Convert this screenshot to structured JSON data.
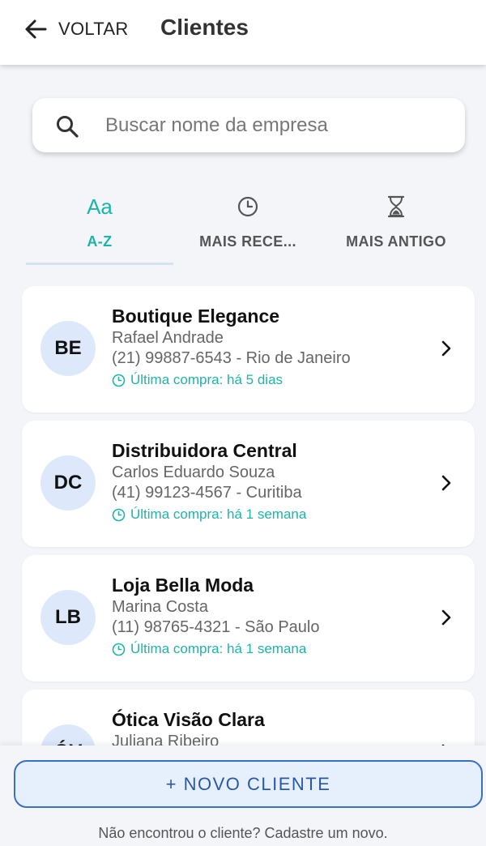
{
  "header": {
    "back_label": "VOLTAR",
    "title": "Clientes"
  },
  "search": {
    "placeholder": "Buscar nome da empresa",
    "value": ""
  },
  "sort_tabs": [
    {
      "icon": "aa-icon",
      "icon_text": "Aa",
      "label": "A-Z",
      "active": true
    },
    {
      "icon": "clock-icon",
      "label": "MAIS RECE...",
      "active": false
    },
    {
      "icon": "hourglass-icon",
      "label": "MAIS ANTIGO",
      "active": false
    }
  ],
  "clients": [
    {
      "initials": "BE",
      "name": "Boutique Elegance",
      "contact": "Rafael Andrade",
      "phone_city": "(21) 99887-6543 - Rio de Janeiro",
      "last_purchase": "Última compra: há 5 dias"
    },
    {
      "initials": "DC",
      "name": "Distribuidora Central",
      "contact": "Carlos Eduardo Souza",
      "phone_city": "(41) 99123-4567 - Curitiba",
      "last_purchase": "Última compra: há 1 semana"
    },
    {
      "initials": "LB",
      "name": "Loja Bella Moda",
      "contact": "Marina Costa",
      "phone_city": "(11) 98765-4321 - São Paulo",
      "last_purchase": "Última compra: há 1 semana"
    },
    {
      "initials": "ÓV",
      "name": "Ótica Visão Clara",
      "contact": "Juliana Ribeiro",
      "phone_city": "",
      "last_purchase": ""
    }
  ],
  "footer": {
    "new_button_label": "+ NOVO CLIENTE",
    "hint": "Não encontrou o cliente? Cadastre um novo."
  },
  "colors": {
    "accent_teal": "#1cb5a8",
    "primary_blue": "#3a6fc2",
    "avatar_bg": "#dde9fb",
    "background": "#f3f5f9"
  }
}
